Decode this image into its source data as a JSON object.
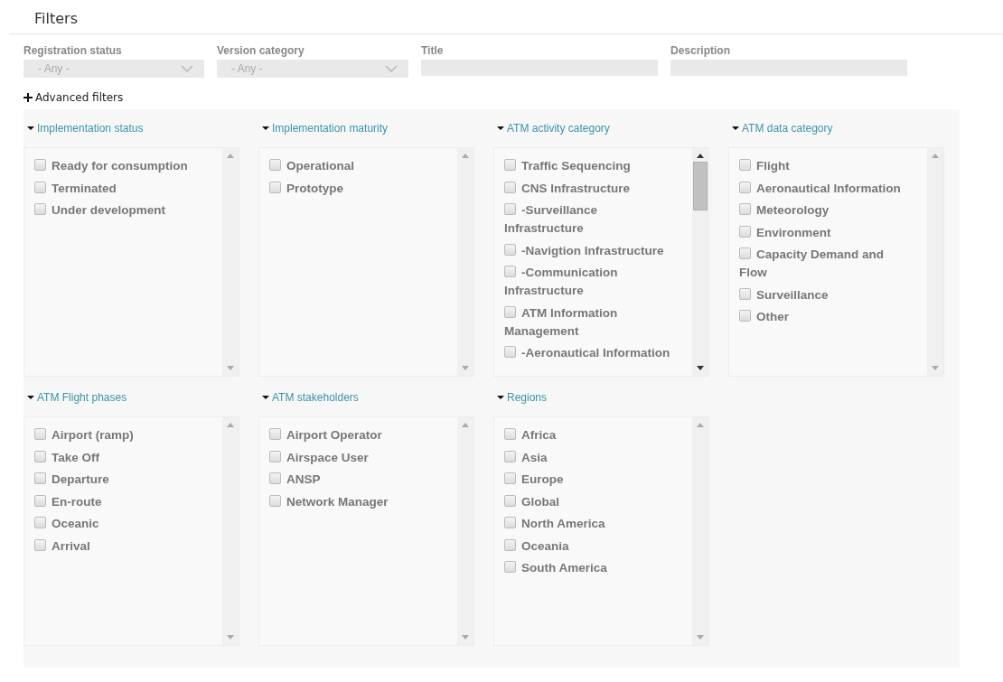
{
  "title": "Filters",
  "fields": [
    {
      "label": "Registration status",
      "kind": "select",
      "value": "- Any -"
    },
    {
      "label": "Version category",
      "kind": "select",
      "value": "- Any -"
    },
    {
      "label": "Title",
      "kind": "text"
    },
    {
      "label": "Description",
      "kind": "text"
    }
  ],
  "advanced_filters": {
    "label": "Advanced filters"
  },
  "groups": [
    {
      "title": "Implementation status",
      "expanded": true,
      "scrolled": false,
      "items": [
        {
          "label": "Ready for consumption",
          "checked": false
        },
        {
          "label": "Terminated",
          "checked": false
        },
        {
          "label": "Under development",
          "checked": false
        }
      ]
    },
    {
      "title": "Implementation maturity",
      "expanded": true,
      "scrolled": false,
      "items": [
        {
          "label": "Operational",
          "checked": false
        },
        {
          "label": "Prototype",
          "checked": false
        }
      ]
    },
    {
      "title": "ATM activity category",
      "expanded": true,
      "scrolled": true,
      "items": [
        {
          "label": "Traffic Sequencing",
          "checked": false
        },
        {
          "label": "CNS Infrastructure",
          "checked": false
        },
        {
          "label": "-Surveillance Infrastructure",
          "checked": false
        },
        {
          "label": "-Navigtion Infrastructure",
          "checked": false
        },
        {
          "label": "-Communication Infrastructure",
          "checked": false
        },
        {
          "label": "ATM Information Management",
          "checked": false
        },
        {
          "label": "-Aeronautical Information",
          "checked": false
        }
      ]
    },
    {
      "title": "ATM data category",
      "expanded": true,
      "scrolled": false,
      "items": [
        {
          "label": "Flight",
          "checked": false
        },
        {
          "label": "Aeronautical Information",
          "checked": false
        },
        {
          "label": "Meteorology",
          "checked": false
        },
        {
          "label": "Environment",
          "checked": false
        },
        {
          "label": "Capacity Demand and Flow",
          "checked": false
        },
        {
          "label": "Surveillance",
          "checked": false
        },
        {
          "label": "Other",
          "checked": false
        }
      ]
    },
    {
      "title": "ATM Flight phases",
      "expanded": true,
      "scrolled": false,
      "items": [
        {
          "label": "Airport (ramp)",
          "checked": false
        },
        {
          "label": "Take Off",
          "checked": false
        },
        {
          "label": "Departure",
          "checked": false
        },
        {
          "label": "En-route",
          "checked": false
        },
        {
          "label": "Oceanic",
          "checked": false
        },
        {
          "label": "Arrival",
          "checked": false
        }
      ]
    },
    {
      "title": "ATM stakeholders",
      "expanded": true,
      "scrolled": false,
      "items": [
        {
          "label": "Airport Operator",
          "checked": false
        },
        {
          "label": "Airspace User",
          "checked": false
        },
        {
          "label": "ANSP",
          "checked": false
        },
        {
          "label": "Network Manager",
          "checked": false
        }
      ]
    },
    {
      "title": "Regions",
      "expanded": true,
      "scrolled": false,
      "items": [
        {
          "label": "Africa",
          "checked": false
        },
        {
          "label": "Asia",
          "checked": false
        },
        {
          "label": "Europe",
          "checked": false
        },
        {
          "label": "Global",
          "checked": false
        },
        {
          "label": "North America",
          "checked": false
        },
        {
          "label": "Oceania",
          "checked": false
        },
        {
          "label": "South America",
          "checked": false
        }
      ]
    }
  ]
}
